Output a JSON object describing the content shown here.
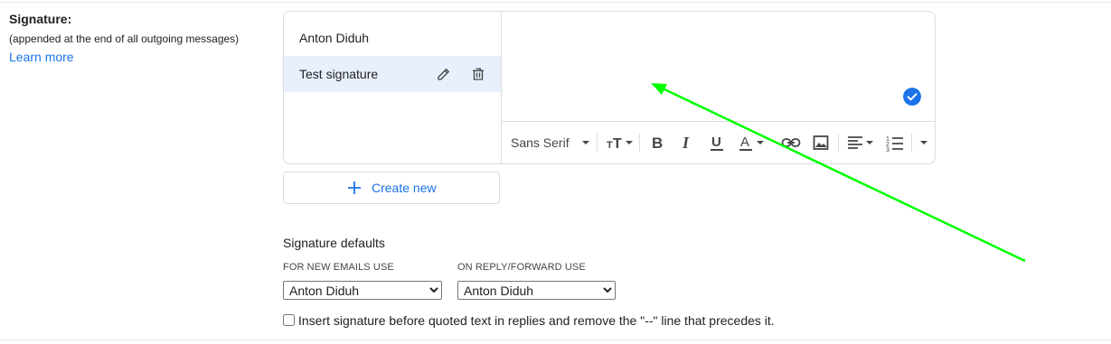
{
  "section": {
    "title": "Signature:",
    "subtitle": "(appended at the end of all outgoing messages)",
    "learn_more": "Learn more"
  },
  "signatures": [
    {
      "name": "Anton Diduh",
      "selected": false
    },
    {
      "name": "Test signature",
      "selected": true
    }
  ],
  "toolbar": {
    "font": "Sans Serif",
    "icons": [
      "font-size-icon",
      "bold-icon",
      "italic-icon",
      "underline-icon",
      "text-color-icon",
      "link-icon",
      "image-icon",
      "align-icon",
      "numbered-list-icon",
      "more-options-icon"
    ]
  },
  "create_new": "Create new",
  "defaults": {
    "title": "Signature defaults",
    "new_emails_label": "FOR NEW EMAILS USE",
    "new_emails_value": "Anton Diduh",
    "reply_label": "ON REPLY/FORWARD USE",
    "reply_value": "Anton Diduh",
    "options": [
      "Anton Diduh",
      "Test signature"
    ]
  },
  "insert_checkbox": {
    "label": "Insert signature before quoted text in replies and remove the \"--\" line that precedes it.",
    "checked": false
  },
  "colors": {
    "accent": "#1a73e8",
    "selected_bg": "#e8f0fe",
    "annotation_arrow": "#00ff00"
  }
}
